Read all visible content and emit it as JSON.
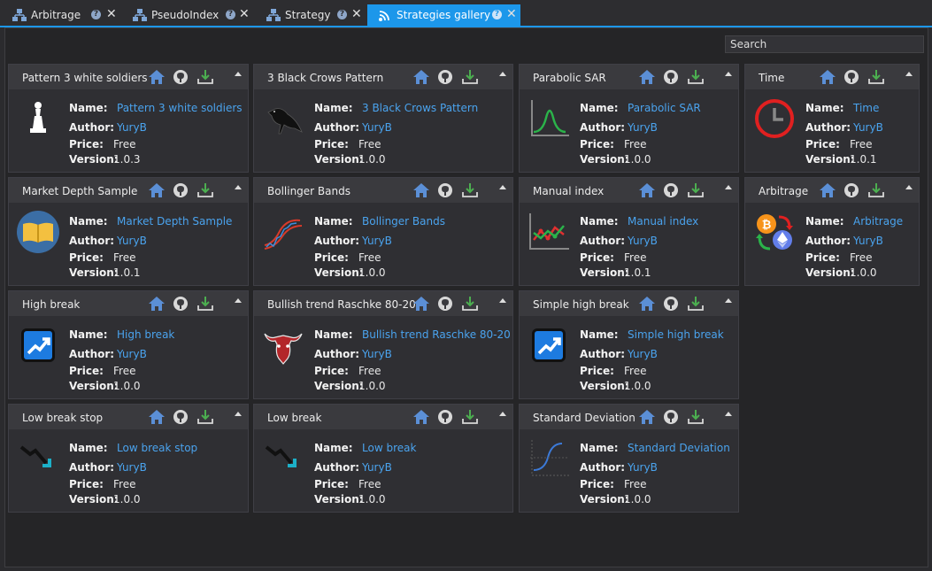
{
  "tabs": [
    {
      "label": "Arbitrage",
      "icon": "hierarchy-icon",
      "active": false
    },
    {
      "label": "PseudoIndex",
      "icon": "hierarchy-icon",
      "active": false
    },
    {
      "label": "Strategy",
      "icon": "hierarchy-icon",
      "active": false
    },
    {
      "label": "Strategies gallery",
      "icon": "wifi-feed-icon",
      "active": true
    }
  ],
  "search": {
    "placeholder": "Search"
  },
  "field_labels": {
    "name": "Name:",
    "author": "Author:",
    "price": "Price:",
    "version": "Version:"
  },
  "cards": [
    {
      "title": "Pattern 3 white soldiers",
      "name": "Pattern 3 white soldiers",
      "author": "YuryB",
      "price": "Free",
      "version": "1.0.3",
      "icon": "white-chess-piece-icon"
    },
    {
      "title": "3 Black Crows Pattern",
      "name": "3 Black Crows Pattern",
      "author": "YuryB",
      "price": "Free",
      "version": "1.0.0",
      "icon": "black-crow-icon"
    },
    {
      "title": "Parabolic SAR",
      "name": "Parabolic SAR",
      "author": "YuryB",
      "price": "Free",
      "version": "1.0.0",
      "icon": "bell-curve-chart-icon"
    },
    {
      "title": "Time",
      "name": "Time",
      "author": "YuryB",
      "price": "Free",
      "version": "1.0.1",
      "icon": "red-clock-icon"
    },
    {
      "title": "Market Depth Sample",
      "name": "Market Depth Sample",
      "author": "YuryB",
      "price": "Free",
      "version": "1.0.1",
      "icon": "open-book-icon"
    },
    {
      "title": "Bollinger Bands",
      "name": "Bollinger Bands",
      "author": "YuryB",
      "price": "Free",
      "version": "1.0.0",
      "icon": "bands-chart-icon"
    },
    {
      "title": "Manual index",
      "name": "Manual index",
      "author": "YuryB",
      "price": "Free",
      "version": "1.0.1",
      "icon": "line-chart-points-icon"
    },
    {
      "title": "Arbitrage",
      "name": "Arbitrage",
      "author": "YuryB",
      "price": "Free",
      "version": "1.0.0",
      "icon": "crypto-exchange-icon"
    },
    {
      "title": "High break",
      "name": "High break",
      "author": "YuryB",
      "price": "Free",
      "version": "1.0.0",
      "icon": "trend-up-icon"
    },
    {
      "title": "Bullish trend Raschke 80-20",
      "name": "Bullish trend Raschke 80-20",
      "author": "YuryB",
      "price": "Free",
      "version": "1.0.0",
      "icon": "bull-head-icon"
    },
    {
      "title": "Simple high break",
      "name": "Simple high break",
      "author": "YuryB",
      "price": "Free",
      "version": "1.0.0",
      "icon": "trend-up-icon"
    },
    {
      "title": "Low break stop",
      "name": "Low break stop",
      "author": "YuryB",
      "price": "Free",
      "version": "1.0.0",
      "icon": "trend-down-icon"
    },
    {
      "title": "Low break",
      "name": "Low break",
      "author": "YuryB",
      "price": "Free",
      "version": "1.0.0",
      "icon": "trend-down-icon"
    },
    {
      "title": "Standard Deviation",
      "name": "Standard Deviation",
      "author": "YuryB",
      "price": "Free",
      "version": "1.0.0",
      "icon": "std-deviation-chart-icon"
    }
  ],
  "colors": {
    "accent": "#1c97ea",
    "link": "#4aa3ee",
    "background": "#252527",
    "card": "#2f2f33",
    "card_header": "#3a3a3e"
  }
}
